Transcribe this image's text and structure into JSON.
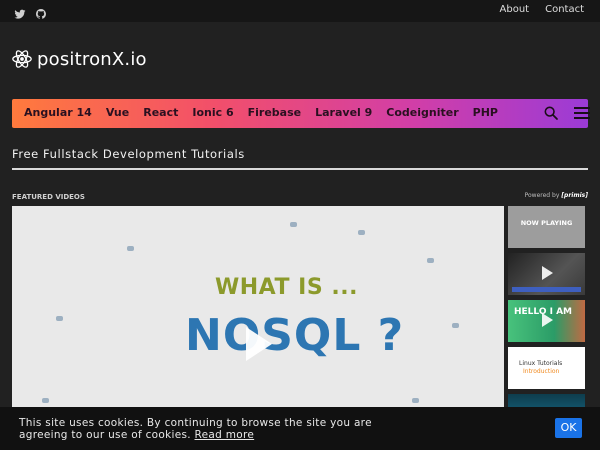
{
  "topbar": {
    "social": [
      "twitter-icon",
      "github-icon"
    ],
    "links": [
      "About",
      "Contact"
    ]
  },
  "brand": {
    "logo_text": "positronX.io",
    "logo_icon": "atom-icon"
  },
  "nav": {
    "items": [
      "Angular 14",
      "Vue",
      "React",
      "Ionic 6",
      "Firebase",
      "Laravel 9",
      "Codeigniter",
      "PHP"
    ],
    "search_icon": "search-icon",
    "menu_icon": "hamburger-icon",
    "gradient": [
      "#ff7a3d",
      "#f24f6a",
      "#d13ea8",
      "#9b3bd6"
    ]
  },
  "tagline": "Free Fullstack Development Tutorials",
  "featured": {
    "label": "FEATURED VIDEOS",
    "powered_prefix": "Powered by",
    "powered_brand": "[primis]",
    "video": {
      "line1": "WHAT IS ...",
      "line2": "NOSQL ?"
    },
    "thumbnails": [
      {
        "text": "NOW PLAYING"
      },
      {
        "text": ""
      },
      {
        "text": "HELLO I AM"
      },
      {
        "line1": "Linux Tutorials",
        "line2": "Introduction"
      },
      {
        "text": ""
      }
    ]
  },
  "cookie": {
    "message": "This site uses cookies. By continuing to browse the site you are agreeing to our use of cookies.",
    "link": "Read more",
    "ok_label": "OK",
    "ok_color": "#1a73e8"
  }
}
